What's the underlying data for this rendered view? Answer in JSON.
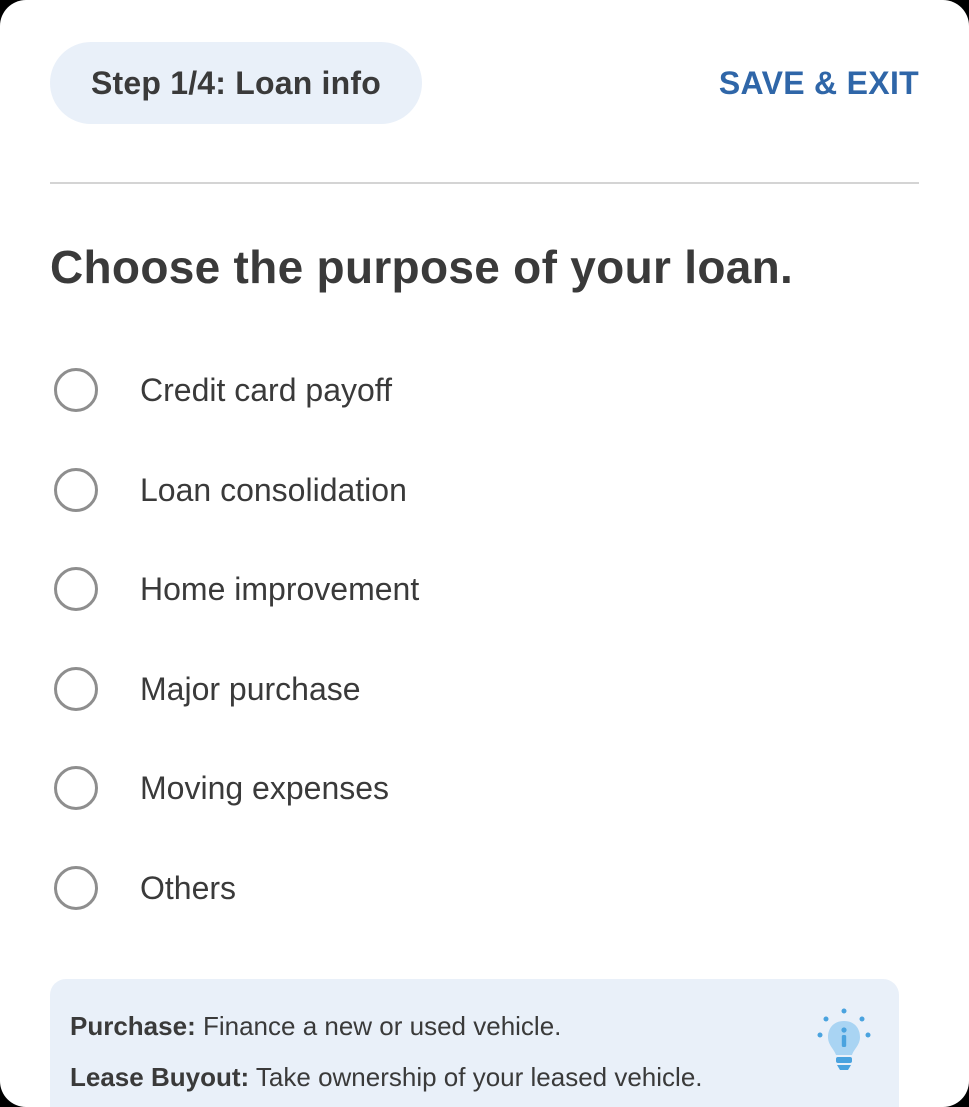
{
  "header": {
    "step_label": "Step 1/4: Loan info",
    "save_exit_label": "SAVE & EXIT"
  },
  "main": {
    "title": "Choose the purpose of your loan.",
    "options": [
      {
        "label": "Credit card payoff",
        "selected": false
      },
      {
        "label": "Loan consolidation",
        "selected": false
      },
      {
        "label": "Home improvement",
        "selected": false
      },
      {
        "label": "Major purchase",
        "selected": false
      },
      {
        "label": "Moving expenses",
        "selected": false
      },
      {
        "label": "Others",
        "selected": false
      }
    ]
  },
  "info": {
    "lines": [
      {
        "term": "Purchase:",
        "description": "Finance a new or used vehicle."
      },
      {
        "term": "Lease Buyout:",
        "description": "Take ownership of your leased vehicle."
      }
    ],
    "icon": "lightbulb-info-icon"
  },
  "colors": {
    "accent": "#2f66a8",
    "pill_background": "#e9f0f9",
    "text": "#3a3a3a",
    "radio_border": "#8e8e8e",
    "bulb": "#4aa3df"
  }
}
